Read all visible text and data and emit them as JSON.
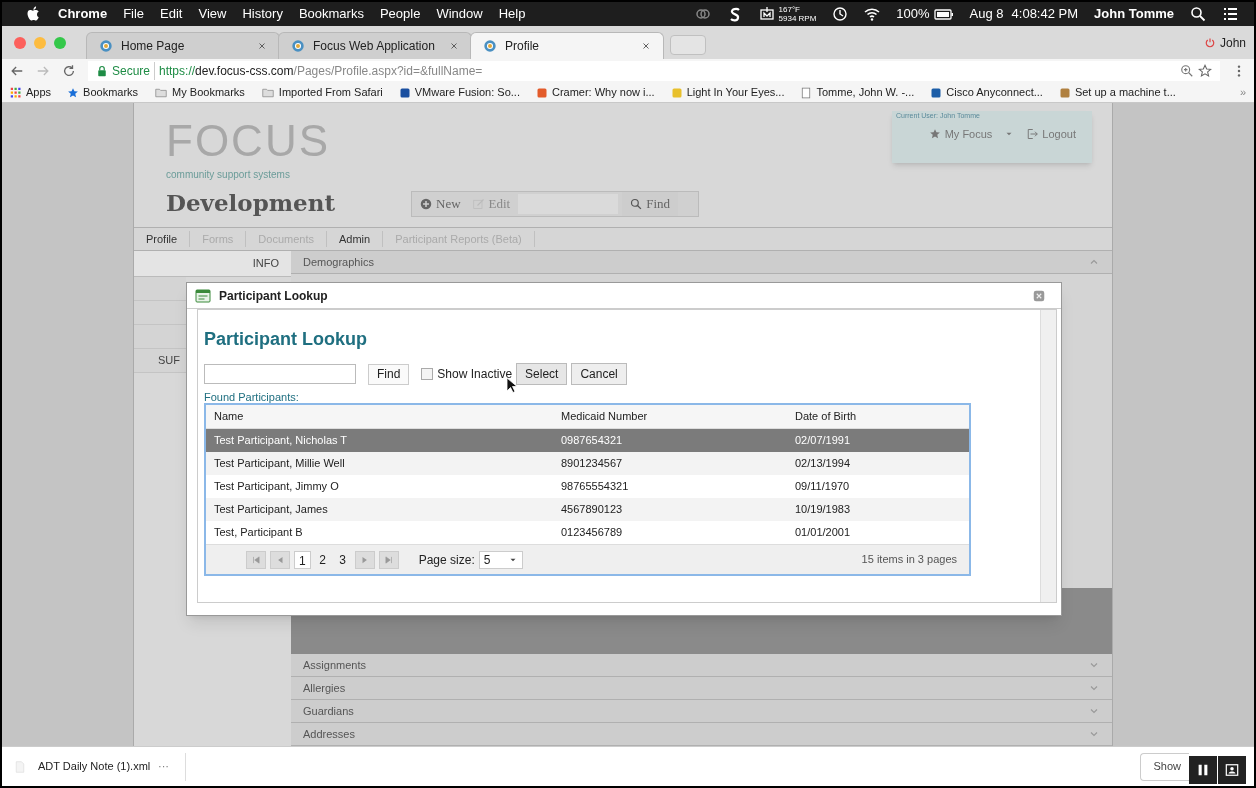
{
  "menu_bar": {
    "app": "Chrome",
    "menus": [
      "File",
      "Edit",
      "View",
      "History",
      "Bookmarks",
      "People",
      "Window",
      "Help"
    ],
    "temperature": "167°F",
    "fan_speed": "5934 RPM",
    "battery": "100%",
    "date": "Aug 8",
    "time": "4:08:42 PM",
    "user": "John Tomme"
  },
  "browser": {
    "tabs": [
      {
        "label": "Home Page",
        "selected": false
      },
      {
        "label": "Focus Web Application",
        "selected": false
      },
      {
        "label": "Profile",
        "selected": true
      }
    ],
    "profile": "John",
    "secure_label": "Secure",
    "url_scheme": "https://",
    "url_host": "dev.focus-css.com",
    "url_path": "/Pages/Profile.aspx?id=&fullName=",
    "bookmarks": [
      {
        "label": "Apps",
        "kind": "apps"
      },
      {
        "label": "Bookmarks",
        "kind": "star"
      },
      {
        "label": "My Bookmarks",
        "kind": "folder"
      },
      {
        "label": "Imported From Safari",
        "kind": "folder"
      },
      {
        "label": "VMware Fusion: So...",
        "kind": "site"
      },
      {
        "label": "Cramer: Why now i...",
        "kind": "site"
      },
      {
        "label": "Light In Your Eyes...",
        "kind": "site"
      },
      {
        "label": "Tomme, John W. -...",
        "kind": "page"
      },
      {
        "label": "Cisco Anyconnect...",
        "kind": "site"
      },
      {
        "label": "Set up a machine t...",
        "kind": "site"
      }
    ],
    "more_bookmarks": "»"
  },
  "header": {
    "logo": "FOCUS",
    "tagline": "community support systems",
    "environment": "Development",
    "new_label": "New",
    "edit_label": "Edit",
    "find_label": "Find",
    "current_user": "Current User: John Tomme",
    "my_focus": "My Focus",
    "logout": "Logout"
  },
  "nav": [
    {
      "label": "Profile",
      "disabled": false
    },
    {
      "label": "Forms",
      "disabled": true
    },
    {
      "label": "Documents",
      "disabled": true
    },
    {
      "label": "Admin",
      "disabled": false
    },
    {
      "label": "Participant Reports (Beta)",
      "disabled": true
    }
  ],
  "info_tab": "INFO",
  "sidebar_item": "SUF",
  "sections": [
    {
      "label": "Demographics",
      "expanded": true
    },
    {
      "label": "Assignments",
      "expanded": false
    },
    {
      "label": "Allergies",
      "expanded": false
    },
    {
      "label": "Guardians",
      "expanded": false
    },
    {
      "label": "Addresses",
      "expanded": false
    }
  ],
  "dialog": {
    "title": "Participant Lookup",
    "heading": "Participant Lookup",
    "find": "Find",
    "show_inactive": {
      "label": "Show Inactive",
      "checked": false
    },
    "select": "Select",
    "cancel": "Cancel",
    "found_label": "Found Participants:",
    "table": {
      "columns": [
        "Name",
        "Medicaid Number",
        "Date of Birth"
      ],
      "rows": [
        {
          "cells": [
            "Test Participant, Nicholas T",
            "0987654321",
            "02/07/1991"
          ],
          "selected": true
        },
        {
          "cells": [
            "Test Participant, Millie Well",
            "8901234567",
            "02/13/1994"
          ],
          "selected": false
        },
        {
          "cells": [
            "Test Participant, Jimmy O",
            "98765554321",
            "09/11/1970"
          ],
          "selected": false
        },
        {
          "cells": [
            "Test Participant, James",
            "4567890123",
            "10/19/1983"
          ],
          "selected": false
        },
        {
          "cells": [
            "Test, Participant B",
            "0123456789",
            "01/01/2001"
          ],
          "selected": false
        }
      ]
    },
    "pager": {
      "pages": [
        {
          "label": "1",
          "selected": true
        },
        {
          "label": "2",
          "selected": false
        },
        {
          "label": "3",
          "selected": false
        }
      ],
      "page_size_label": "Page size:",
      "page_size": "5",
      "summary": "15 items in 3 pages"
    }
  },
  "downloads": {
    "file": "ADT Daily Note (1).xml",
    "more": "···",
    "show_all": "Show"
  }
}
